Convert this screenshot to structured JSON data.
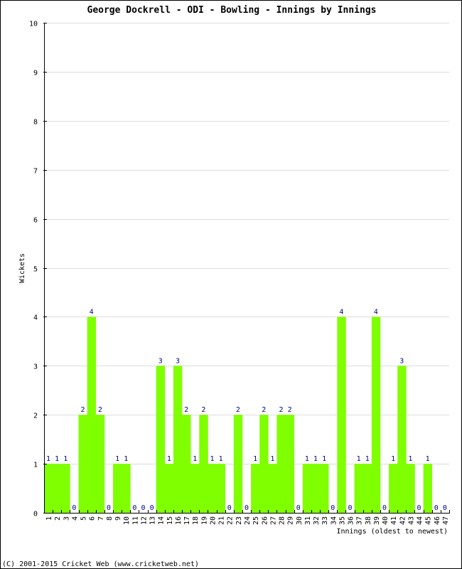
{
  "chart_data": {
    "type": "bar",
    "title": "George Dockrell - ODI - Bowling - Innings by Innings",
    "xlabel": "Innings (oldest to newest)",
    "ylabel": "Wickets",
    "ylim": [
      0,
      10
    ],
    "yticks": [
      0,
      1,
      2,
      3,
      4,
      5,
      6,
      7,
      8,
      9,
      10
    ],
    "grid": true,
    "categories": [
      "1",
      "2",
      "3",
      "4",
      "5",
      "6",
      "7",
      "8",
      "9",
      "10",
      "11",
      "12",
      "13",
      "14",
      "15",
      "16",
      "17",
      "18",
      "19",
      "20",
      "21",
      "22",
      "23",
      "24",
      "25",
      "26",
      "27",
      "28",
      "29",
      "30",
      "31",
      "32",
      "33",
      "34",
      "35",
      "36",
      "37",
      "38",
      "39",
      "40",
      "41",
      "42",
      "43",
      "44",
      "45",
      "46",
      "47"
    ],
    "values": [
      1,
      1,
      1,
      0,
      2,
      4,
      2,
      0,
      1,
      1,
      0,
      0,
      0,
      3,
      1,
      3,
      2,
      1,
      2,
      1,
      1,
      0,
      2,
      0,
      1,
      2,
      1,
      2,
      2,
      0,
      1,
      1,
      1,
      0,
      4,
      0,
      1,
      1,
      4,
      0,
      1,
      3,
      1,
      0,
      1,
      0,
      0
    ],
    "bar_color": "#80ff00",
    "label_color": "#000080",
    "grid_color": "#dddddd"
  },
  "footer": "(C) 2001-2015 Cricket Web (www.cricketweb.net)"
}
